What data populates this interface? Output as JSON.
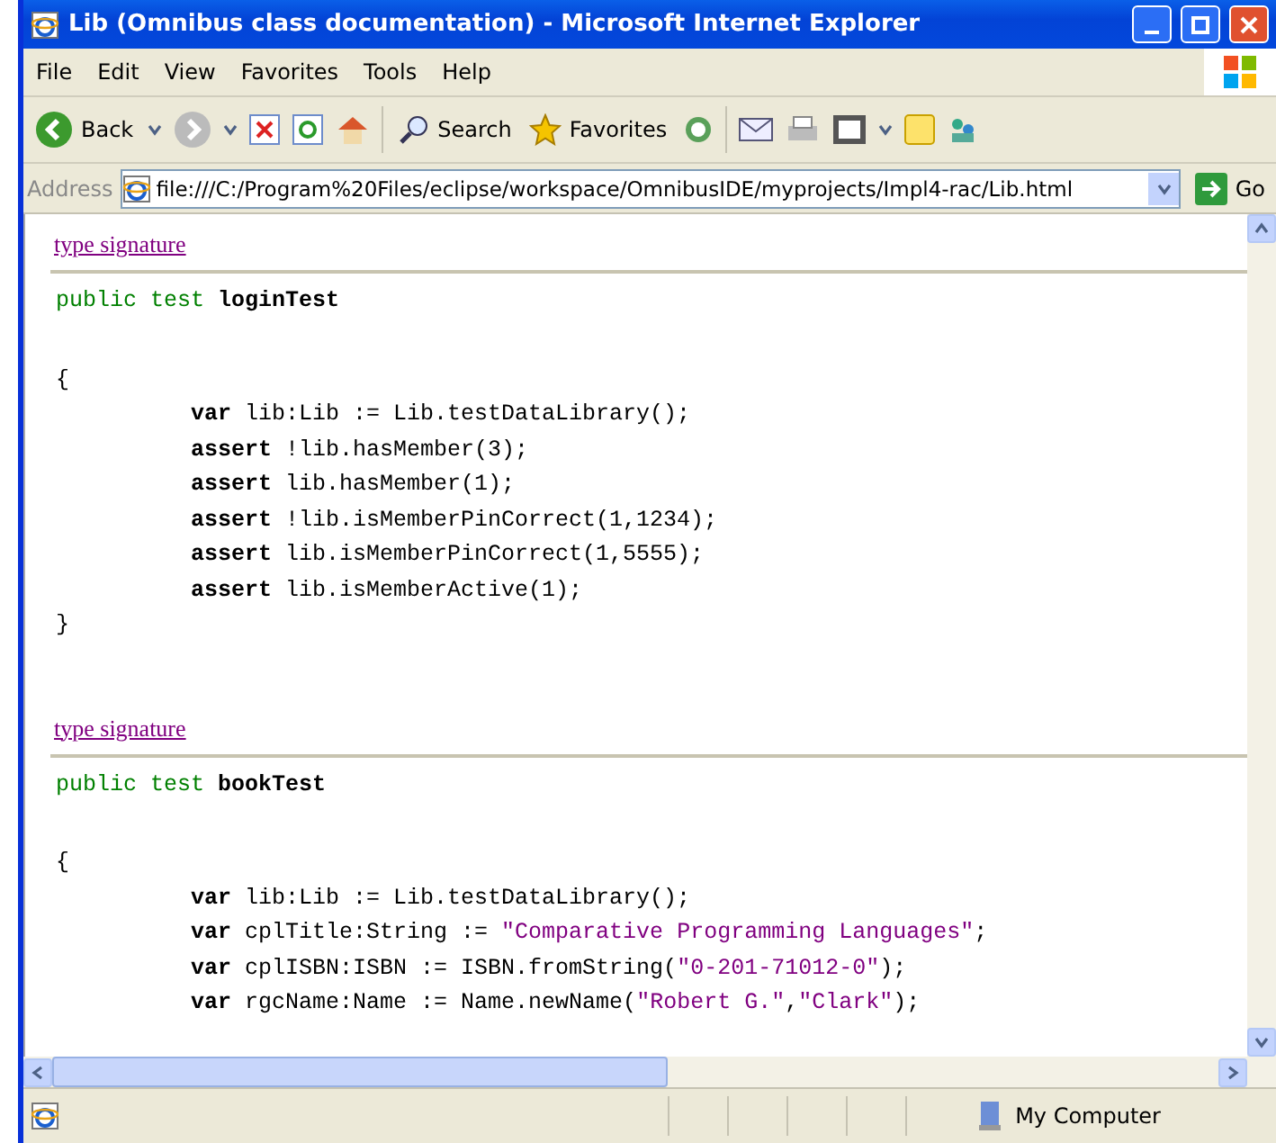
{
  "window": {
    "title": "Lib (Omnibus class documentation) - Microsoft Internet Explorer"
  },
  "menu": [
    "File",
    "Edit",
    "View",
    "Favorites",
    "Tools",
    "Help"
  ],
  "toolbar": {
    "back": "Back",
    "search": "Search",
    "favorites": "Favorites"
  },
  "address": {
    "label": "Address",
    "value": "file:///C:/Program%20Files/eclipse/workspace/OmnibusIDE/myprojects/Impl4-rac/Lib.html",
    "go": "Go"
  },
  "sections": [
    {
      "link": "type signature",
      "modifiers": "public test",
      "name": "loginTest",
      "open": "{",
      "close": "}",
      "lines": [
        [
          {
            "kind": "keyword",
            "text": "var"
          },
          {
            "kind": "plain",
            "text": " lib:Lib := Lib.testDataLibrary();"
          }
        ],
        [
          {
            "kind": "keyword",
            "text": "assert"
          },
          {
            "kind": "plain",
            "text": " !lib.hasMember(3);"
          }
        ],
        [
          {
            "kind": "keyword",
            "text": "assert"
          },
          {
            "kind": "plain",
            "text": " lib.hasMember(1);"
          }
        ],
        [
          {
            "kind": "keyword",
            "text": "assert"
          },
          {
            "kind": "plain",
            "text": " !lib.isMemberPinCorrect(1,1234);"
          }
        ],
        [
          {
            "kind": "keyword",
            "text": "assert"
          },
          {
            "kind": "plain",
            "text": " lib.isMemberPinCorrect(1,5555);"
          }
        ],
        [
          {
            "kind": "keyword",
            "text": "assert"
          },
          {
            "kind": "plain",
            "text": " lib.isMemberActive(1);"
          }
        ]
      ]
    },
    {
      "link": "type signature",
      "modifiers": "public test",
      "name": "bookTest",
      "open": "{",
      "lines": [
        [
          {
            "kind": "keyword",
            "text": "var"
          },
          {
            "kind": "plain",
            "text": " lib:Lib := Lib.testDataLibrary();"
          }
        ],
        [
          {
            "kind": "keyword",
            "text": "var"
          },
          {
            "kind": "plain",
            "text": " cplTitle:String := "
          },
          {
            "kind": "string",
            "text": "\"Comparative Programming Languages\""
          },
          {
            "kind": "plain",
            "text": ";"
          }
        ],
        [
          {
            "kind": "keyword",
            "text": "var"
          },
          {
            "kind": "plain",
            "text": " cplISBN:ISBN := ISBN.fromString("
          },
          {
            "kind": "string",
            "text": "\"0-201-71012-0\""
          },
          {
            "kind": "plain",
            "text": ");"
          }
        ],
        [
          {
            "kind": "keyword",
            "text": "var"
          },
          {
            "kind": "plain",
            "text": " rgcName:Name := Name.newName("
          },
          {
            "kind": "string",
            "text": "\"Robert G.\""
          },
          {
            "kind": "plain",
            "text": ","
          },
          {
            "kind": "string",
            "text": "\"Clark\""
          },
          {
            "kind": "plain",
            "text": ");"
          }
        ]
      ]
    }
  ],
  "status_bar": {
    "zone": "My Computer"
  }
}
